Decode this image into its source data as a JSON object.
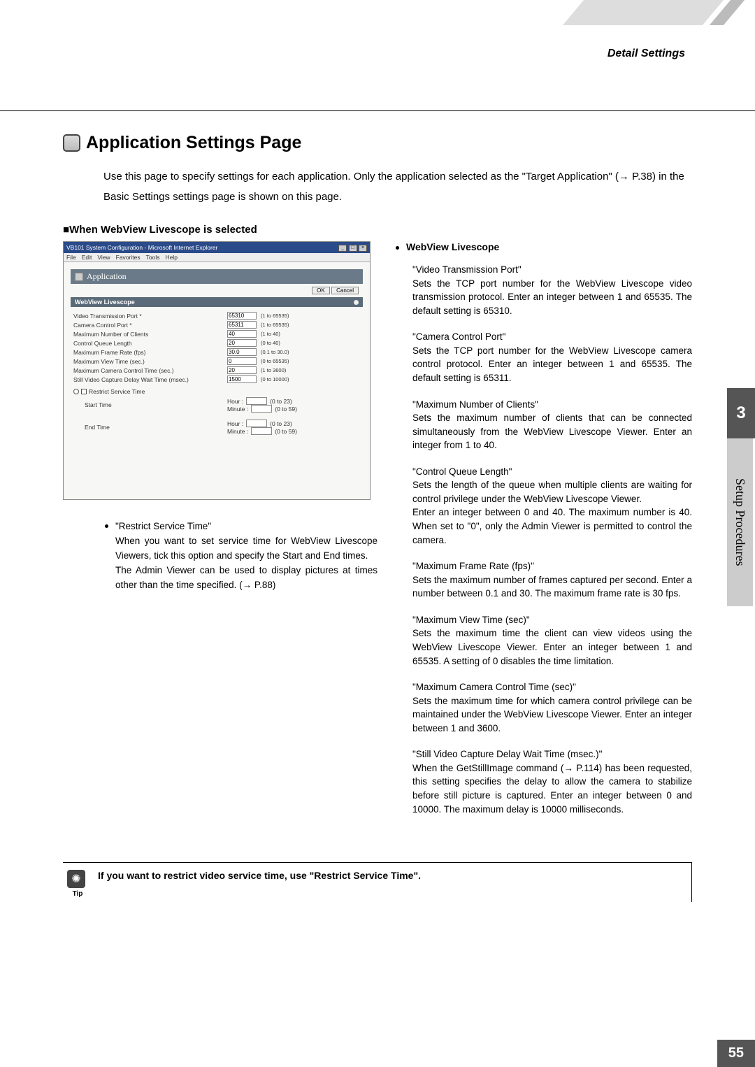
{
  "header": {
    "section": "Detail Settings"
  },
  "title": "Application Settings Page",
  "intro": "Use this page to specify settings for each application. Only the application selected as the \"Target Application\" (→ P.38) in the Basic Settings settings page is shown on this page.",
  "when_heading": "When WebView Livescope is selected",
  "screenshot": {
    "window_title": "VB101 System Configuration - Microsoft Internet Explorer",
    "menus": [
      "File",
      "Edit",
      "View",
      "Favorites",
      "Tools",
      "Help"
    ],
    "app_header": "Application",
    "ok": "OK",
    "cancel": "Cancel",
    "wv_header": "WebView Livescope",
    "rows": [
      {
        "label": "Video Transmission Port *",
        "value": "65310",
        "hint": "(1 to 65535)"
      },
      {
        "label": "Camera Control Port *",
        "value": "65311",
        "hint": "(1 to 65535)"
      },
      {
        "label": "Maximum Number of Clients",
        "value": "40",
        "hint": "(1 to 40)"
      },
      {
        "label": "Control Queue Length",
        "value": "20",
        "hint": "(0 to 40)"
      },
      {
        "label": "Maximum Frame Rate (fps)",
        "value": "30.0",
        "hint": "(0.1 to 30.0)"
      },
      {
        "label": "Maximum View Time (sec.)",
        "value": "0",
        "hint": "(0 to 65535)"
      },
      {
        "label": "Maximum Camera Control Time (sec.)",
        "value": "20",
        "hint": "(1 to 3600)"
      },
      {
        "label": "Still Video Capture Delay Wait Time (msec.)",
        "value": "1500",
        "hint": "(0 to 10000)"
      }
    ],
    "restrict_label": "Restrict Service Time",
    "start_label": "Start Time",
    "end_label": "End Time",
    "hour": "Hour :",
    "minute": "Minute :",
    "hour_hint": "(0 to 23)",
    "minute_hint": "(0 to 59)"
  },
  "left_item": {
    "title": "\"Restrict Service Time\"",
    "p1": "When you want to set service time for WebView Livescope Viewers, tick this option and specify the Start and End times.",
    "p2": "The Admin Viewer can be used to display pictures at times other than the time specified.  (→ P.88)"
  },
  "right": {
    "heading": "WebView Livescope",
    "items": [
      {
        "t": "\"Video Transmission Port\"",
        "b": "Sets the TCP port number for the WebView Livescope video transmission protocol. Enter an integer between 1 and 65535. The default setting is 65310."
      },
      {
        "t": "\"Camera Control Port\"",
        "b": "Sets the TCP port number for the WebView Livescope camera control protocol. Enter an integer between 1 and 65535. The default setting is 65311."
      },
      {
        "t": "\"Maximum Number of Clients\"",
        "b": "Sets the maximum number of clients that can be connected simultaneously from the WebView Livescope Viewer. Enter an integer from 1 to 40."
      },
      {
        "t": "\"Control Queue Length\"",
        "b": "Sets the length of the queue when multiple clients are waiting for control privilege under the WebView Livescope Viewer.\nEnter an integer between 0 and 40. The maximum number is 40. When set to \"0\", only the Admin Viewer is permitted to control the camera."
      },
      {
        "t": "\"Maximum Frame Rate (fps)\"",
        "b": "Sets the maximum number of frames captured per second. Enter a number between 0.1 and 30. The maximum frame rate is 30 fps."
      },
      {
        "t": "\"Maximum View Time (sec)\"",
        "b": "Sets the maximum time the client can view videos using the WebView Livescope Viewer. Enter an integer between 1 and 65535. A setting of 0 disables the time limitation."
      },
      {
        "t": "\"Maximum Camera Control Time (sec)\"",
        "b": "Sets the maximum time for which camera control privilege can be maintained under the WebView Livescope Viewer. Enter an integer between 1 and 3600."
      },
      {
        "t": "\"Still Video Capture Delay Wait Time (msec.)\"",
        "b": "When the GetStillImage command (→ P.114) has been requested, this setting specifies the delay to allow the camera to stabilize before still picture is captured. Enter an integer between 0 and 10000. The maximum delay is 10000 milliseconds."
      }
    ]
  },
  "tip": {
    "label": "Tip",
    "text": "If you want to restrict video service time, use \"Restrict Service Time\"."
  },
  "sidebar": {
    "chapter": "3",
    "name": "Setup Procedures"
  },
  "page_number": "55"
}
